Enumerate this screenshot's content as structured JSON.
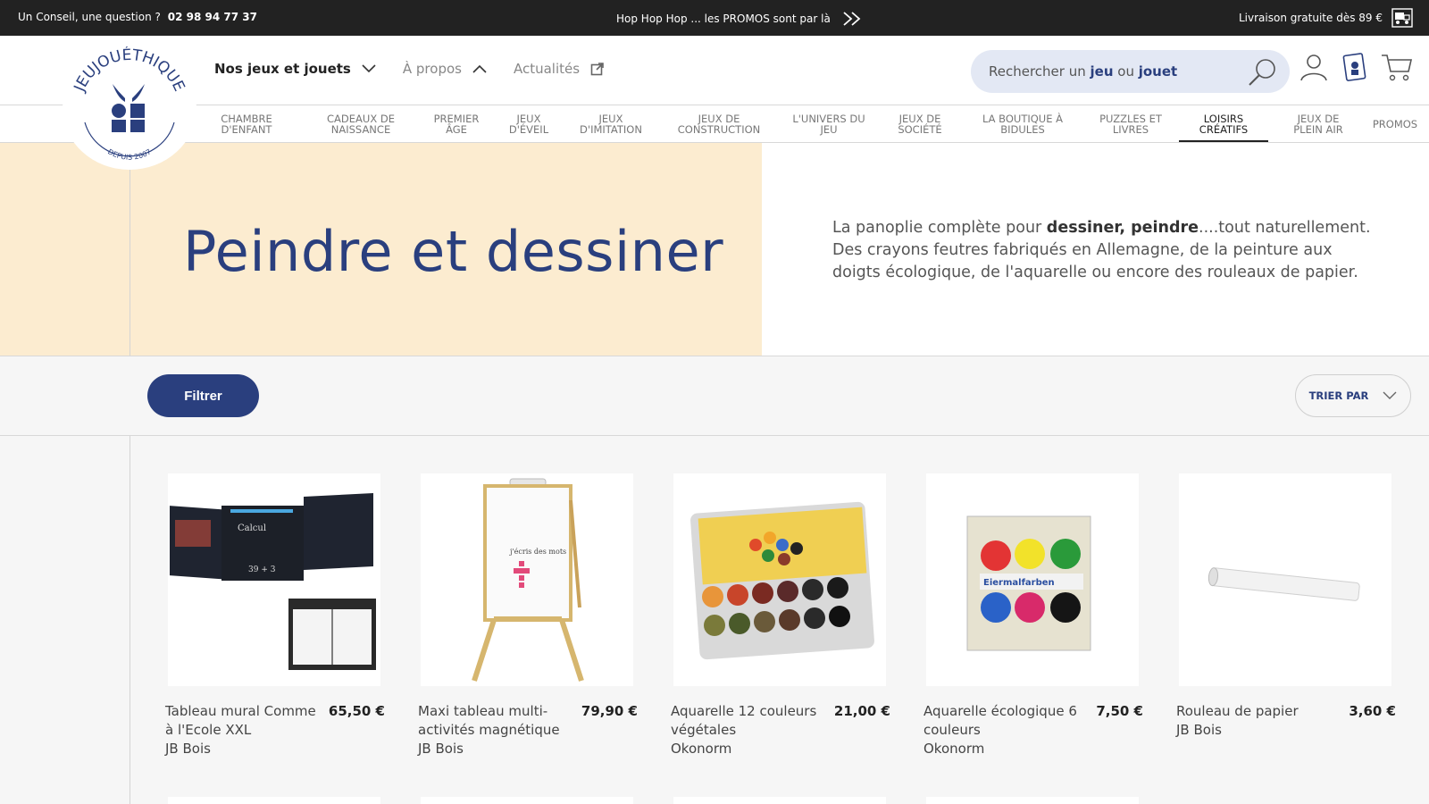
{
  "topbar": {
    "advice_label": "Un Conseil, une question ?",
    "phone": "02 98 94 77 37",
    "promo": "Hop Hop Hop ... les PROMOS sont par là",
    "shipping": "Livraison gratuite dès 89 €"
  },
  "logo": {
    "name": "JEUJOUÉTHIQUE",
    "since": "DEPUIS 2007"
  },
  "mainnav": {
    "items": [
      "Nos jeux et jouets",
      "À propos",
      "Actualités"
    ]
  },
  "search": {
    "prefix": "Rechercher un ",
    "word1": "jeu",
    "mid": " ou ",
    "word2": "jouet"
  },
  "categories": [
    {
      "line1": "CHAMBRE",
      "line2": "D'ENFANT"
    },
    {
      "line1": "CADEAUX DE",
      "line2": "NAISSANCE"
    },
    {
      "line1": "PREMIER",
      "line2": "ÂGE"
    },
    {
      "line1": "JEUX",
      "line2": "D'ÉVEIL"
    },
    {
      "line1": "JEUX",
      "line2": "D'IMITATION"
    },
    {
      "line1": "JEUX DE",
      "line2": "CONSTRUCTION"
    },
    {
      "line1": "L'UNIVERS DU",
      "line2": "JEU"
    },
    {
      "line1": "JEUX DE",
      "line2": "SOCIÉTÉ"
    },
    {
      "line1": "LA BOUTIQUE À",
      "line2": "BIDULES"
    },
    {
      "line1": "PUZZLES ET",
      "line2": "LIVRES"
    },
    {
      "line1": "LOISIRS",
      "line2": "CRÉATIFS"
    },
    {
      "line1": "JEUX DE",
      "line2": "PLEIN AIR"
    },
    {
      "line1": "PROMOS",
      "line2": ""
    }
  ],
  "hero": {
    "title": "Peindre et dessiner",
    "desc_line1_a": "La panoplie complète pour ",
    "desc_line1_b": "dessiner, peindre",
    "desc_line1_c": "....tout naturellement.",
    "desc_line2": "Des crayons feutres fabriqués en Allemagne, de la peinture aux",
    "desc_line3": "doigts écologique,  de l'aquarelle ou encore des rouleaux de papier."
  },
  "filters": {
    "filter_label": "Filtrer",
    "sort_label": "TRIER PAR"
  },
  "products": [
    {
      "name": "Tableau mural Comme à l'Ecole XXL",
      "price": "65,50 €",
      "brand": "JB Bois"
    },
    {
      "name": "Maxi tableau multi-activités magnétique",
      "price": "79,90 €",
      "brand": "JB Bois"
    },
    {
      "name": "Aquarelle 12 couleurs végétales",
      "price": "21,00 €",
      "brand": "Okonorm"
    },
    {
      "name": "Aquarelle écologique 6 couleurs",
      "price": "7,50 €",
      "brand": "Okonorm"
    },
    {
      "name": "Rouleau de papier",
      "price": "3,60 €",
      "brand": "JB Bois"
    }
  ],
  "colors": {
    "brand_blue": "#2a3f7e",
    "hero_bg": "#fcecd0",
    "topbar_bg": "#222222",
    "search_bg": "#e3e8f4"
  }
}
